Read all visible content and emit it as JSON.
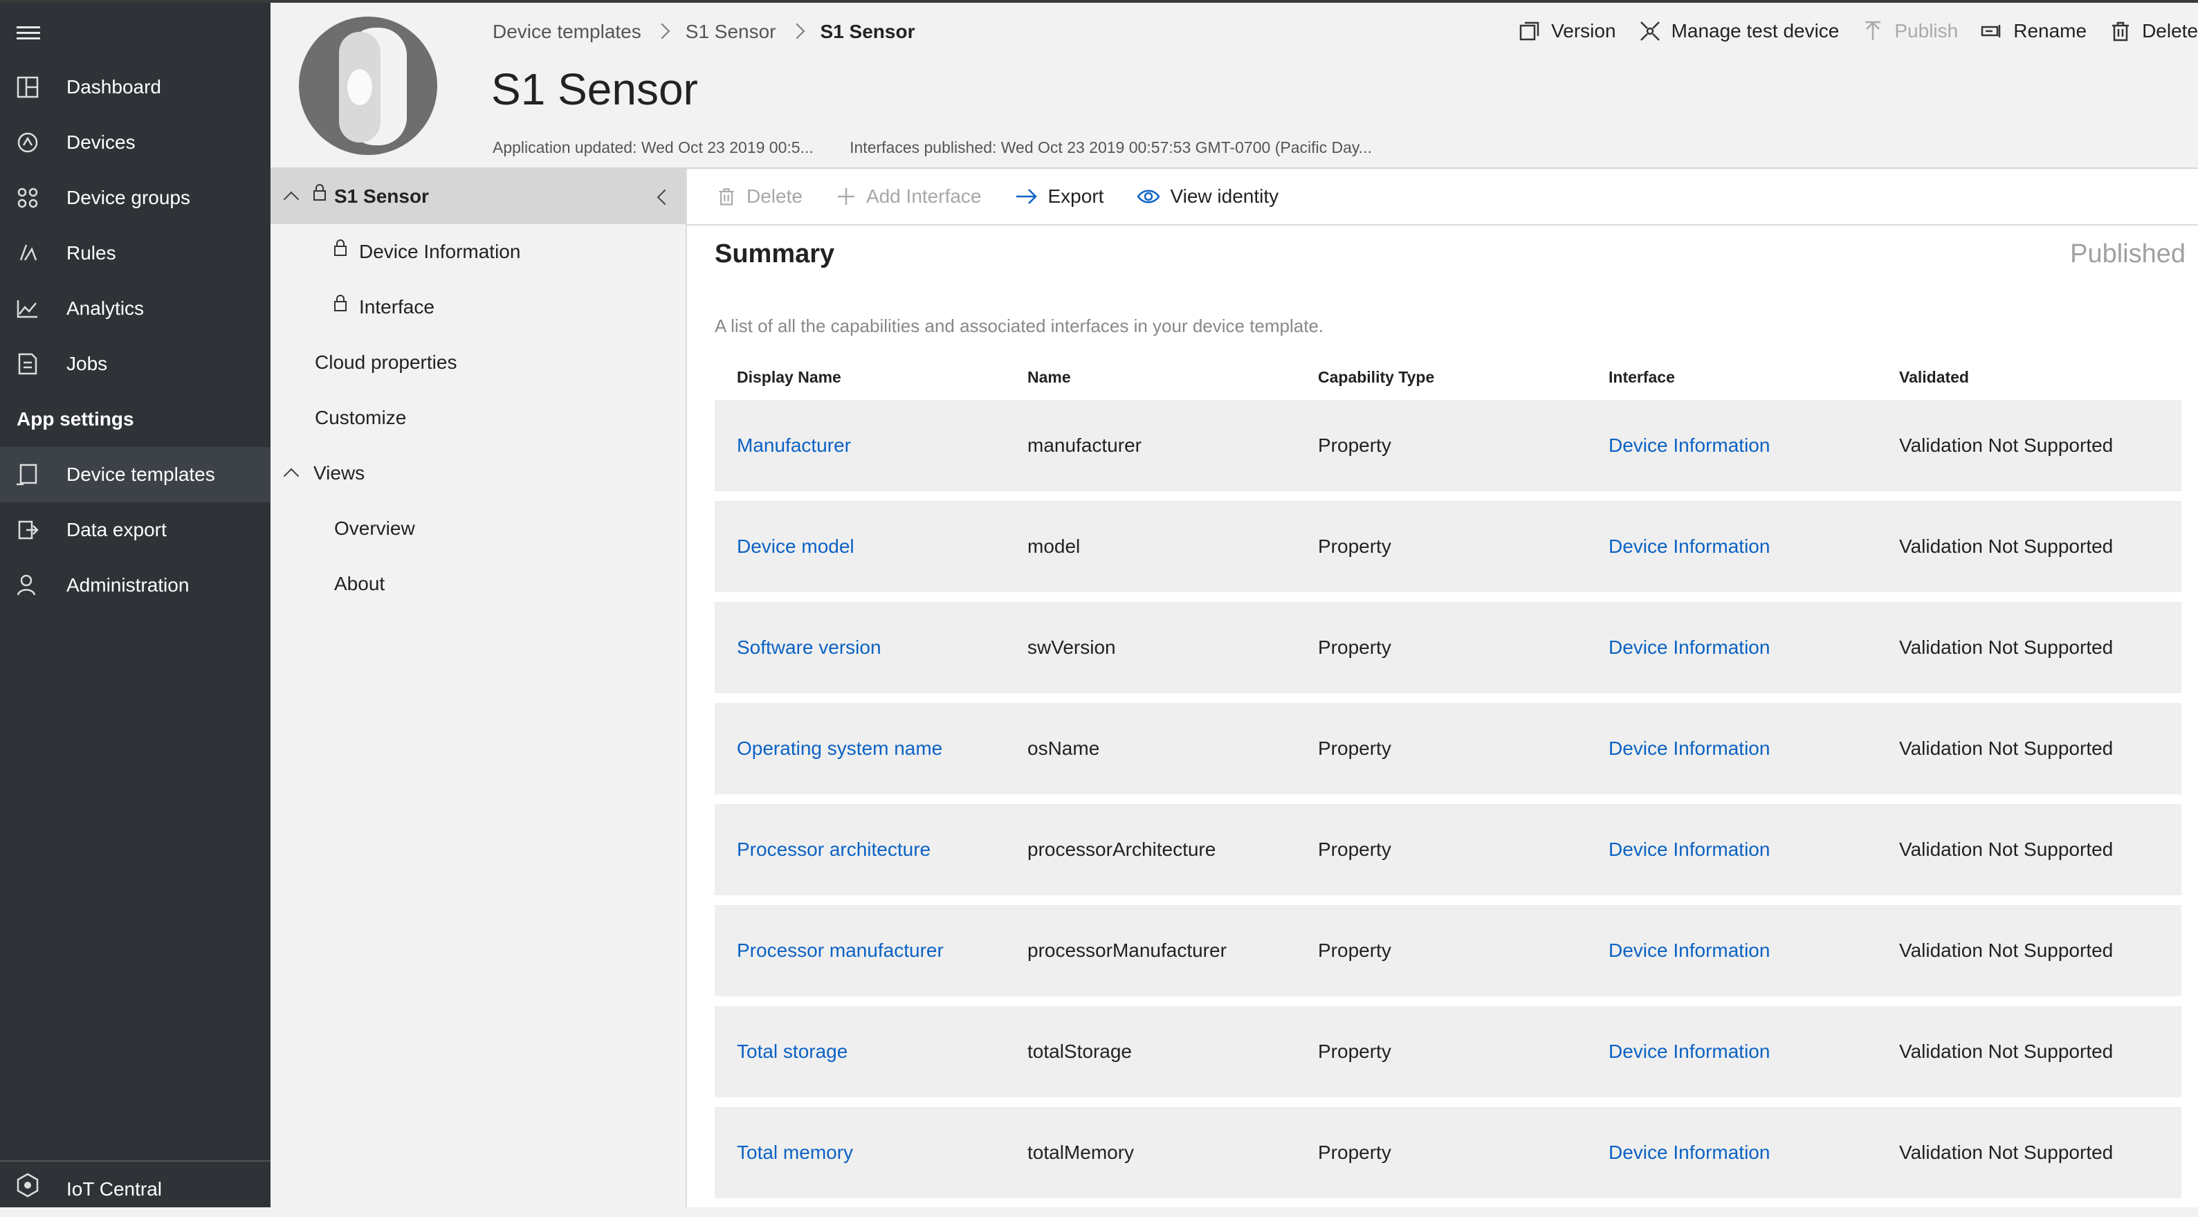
{
  "nav": {
    "items": [
      {
        "label": "Dashboard",
        "icon": "dashboard-icon"
      },
      {
        "label": "Devices",
        "icon": "devices-icon"
      },
      {
        "label": "Device groups",
        "icon": "device-groups-icon"
      },
      {
        "label": "Rules",
        "icon": "rules-icon"
      },
      {
        "label": "Analytics",
        "icon": "analytics-icon"
      },
      {
        "label": "Jobs",
        "icon": "jobs-icon"
      }
    ],
    "section_header": "App settings",
    "settings_items": [
      {
        "label": "Device templates",
        "icon": "device-templates-icon",
        "active": true
      },
      {
        "label": "Data export",
        "icon": "data-export-icon"
      },
      {
        "label": "Administration",
        "icon": "administration-icon"
      }
    ],
    "footer_label": "IoT Central"
  },
  "breadcrumb": {
    "items": [
      "Device templates",
      "S1 Sensor"
    ],
    "current": "S1 Sensor"
  },
  "page": {
    "title": "S1 Sensor",
    "app_updated": "Application updated: Wed Oct 23 2019 00:5...",
    "interfaces_published": "Interfaces published: Wed Oct 23 2019 00:57:53 GMT-0700 (Pacific Day..."
  },
  "toolbar": {
    "version": "Version",
    "manage_test_device": "Manage test device",
    "publish": "Publish",
    "rename": "Rename",
    "delete": "Delete"
  },
  "tree": {
    "root": "S1 Sensor",
    "interfaces": [
      "Device Information",
      "Interface"
    ],
    "cloud_properties": "Cloud properties",
    "customize": "Customize",
    "views": "Views",
    "view_items": [
      "Overview",
      "About"
    ]
  },
  "commands": {
    "delete": "Delete",
    "add_interface": "Add Interface",
    "export": "Export",
    "view_identity": "View identity"
  },
  "summary": {
    "title": "Summary",
    "status": "Published",
    "description": "A list of all the capabilities and associated interfaces in your device template.",
    "columns": [
      "Display Name",
      "Name",
      "Capability Type",
      "Interface",
      "Validated"
    ],
    "rows": [
      {
        "display_name": "Manufacturer",
        "name": "manufacturer",
        "type": "Property",
        "interface": "Device Information",
        "validated": "Validation Not Supported"
      },
      {
        "display_name": "Device model",
        "name": "model",
        "type": "Property",
        "interface": "Device Information",
        "validated": "Validation Not Supported"
      },
      {
        "display_name": "Software version",
        "name": "swVersion",
        "type": "Property",
        "interface": "Device Information",
        "validated": "Validation Not Supported"
      },
      {
        "display_name": "Operating system name",
        "name": "osName",
        "type": "Property",
        "interface": "Device Information",
        "validated": "Validation Not Supported"
      },
      {
        "display_name": "Processor architecture",
        "name": "processorArchitecture",
        "type": "Property",
        "interface": "Device Information",
        "validated": "Validation Not Supported"
      },
      {
        "display_name": "Processor manufacturer",
        "name": "processorManufacturer",
        "type": "Property",
        "interface": "Device Information",
        "validated": "Validation Not Supported"
      },
      {
        "display_name": "Total storage",
        "name": "totalStorage",
        "type": "Property",
        "interface": "Device Information",
        "validated": "Validation Not Supported"
      },
      {
        "display_name": "Total memory",
        "name": "totalMemory",
        "type": "Property",
        "interface": "Device Information",
        "validated": "Validation Not Supported"
      }
    ]
  },
  "colors": {
    "nav_bg": "#2f3337",
    "link": "#0b62c4",
    "row_bg": "#efefef"
  }
}
